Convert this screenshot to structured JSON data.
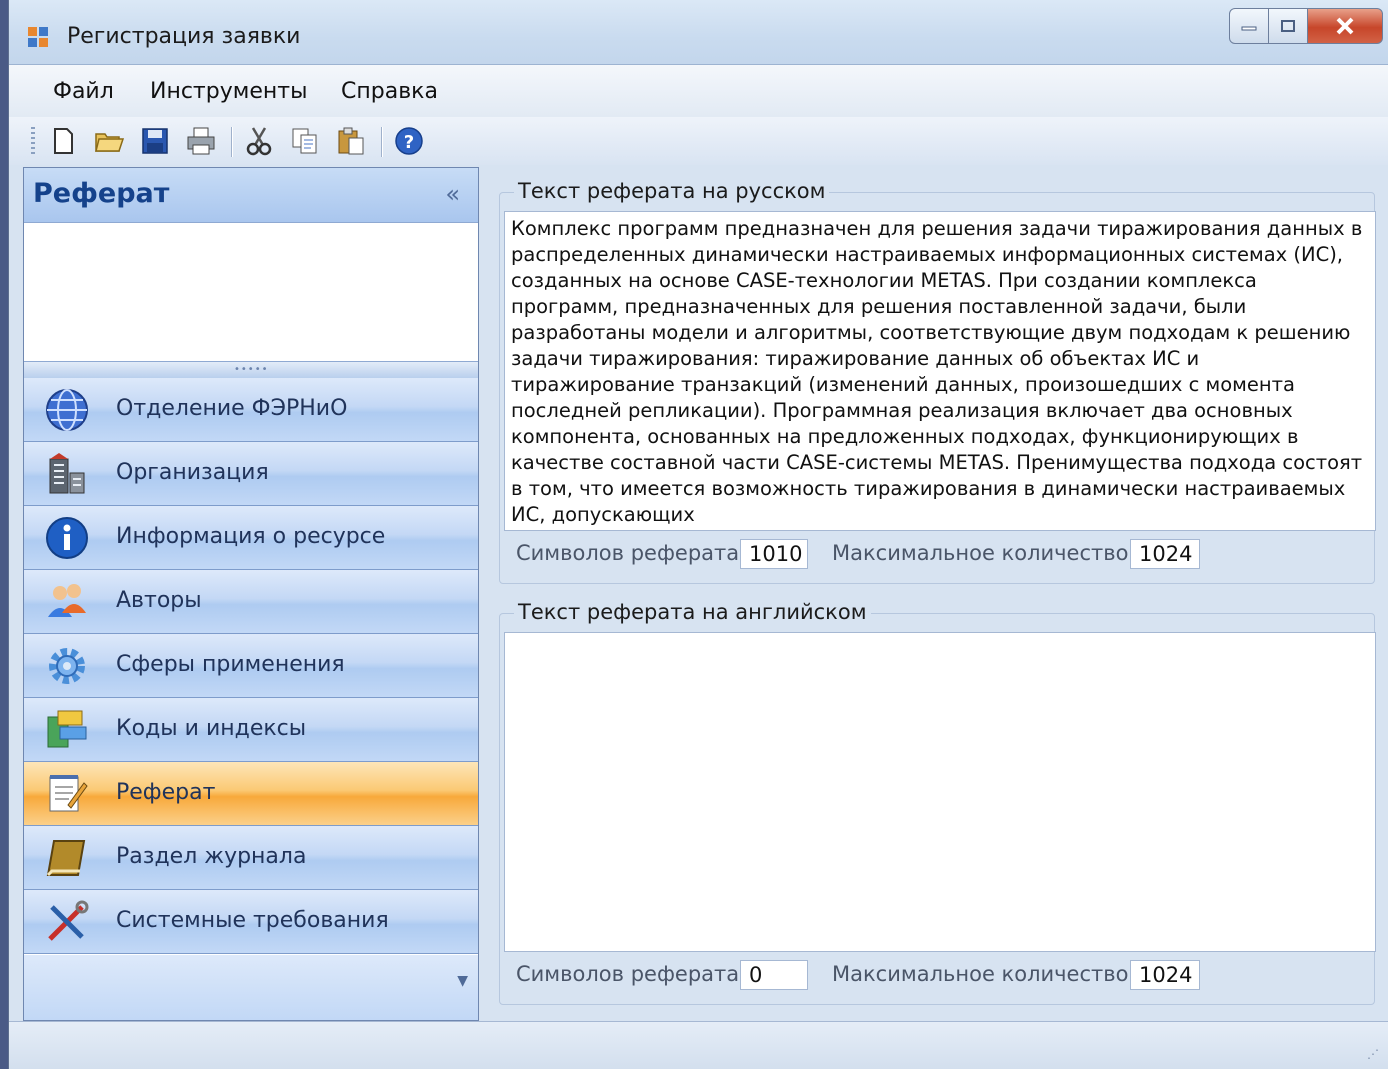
{
  "window": {
    "title": "Регистрация заявки"
  },
  "menu": {
    "file": "Файл",
    "tools": "Инструменты",
    "help": "Справка"
  },
  "toolbar": {
    "icons": [
      "new-icon",
      "open-icon",
      "save-icon",
      "print-icon",
      "cut-icon",
      "copy-icon",
      "paste-icon",
      "help-icon"
    ]
  },
  "navpane": {
    "header": "Реферат",
    "collapse": "«",
    "items": [
      {
        "label": "Отделение ФЭРНиО",
        "icon": "globe-icon"
      },
      {
        "label": "Организация",
        "icon": "building-icon"
      },
      {
        "label": "Информация о ресурсе",
        "icon": "info-icon"
      },
      {
        "label": "Авторы",
        "icon": "users-icon"
      },
      {
        "label": "Сферы применения",
        "icon": "gear-icon"
      },
      {
        "label": "Коды и индексы",
        "icon": "codes-icon"
      },
      {
        "label": "Реферат",
        "icon": "notepad-icon",
        "active": true
      },
      {
        "label": "Раздел журнала",
        "icon": "book-icon"
      },
      {
        "label": "Системные требования",
        "icon": "tools-icon"
      }
    ]
  },
  "russian": {
    "title": "Текст реферата на русском",
    "text": "Комплекс программ предназначен для решения задачи тиражирования данных в распределенных динамически настраиваемых информационных системах (ИС), созданных на основе CASE-технологии METAS. При создании комплекса программ, предназначенных для решения поставленной задачи, были разработаны модели и алгоритмы, соответствующие двум подходам к решению задачи тиражирования: тиражирование данных об объектах ИС и тиражирование транзакций (изменений данных, произошедших с момента последней репликации). Программная реализация включает два основных компонента, основанных на предложенных подходах, функционирующих в качестве составной части CASE-системы METAS. Пренимущества подхода состоят в том, что имеется возможность тиражирования в динамически настраиваемых ИС, допускающих",
    "count_label": "Символов реферата:",
    "count": "1010",
    "max_label": "Максимальное количество:",
    "max": "1024"
  },
  "english": {
    "title": "Текст реферата на английском",
    "text": "",
    "count_label": "Символов реферата:",
    "count": "0",
    "max_label": "Максимальное количество:",
    "max": "1024"
  }
}
